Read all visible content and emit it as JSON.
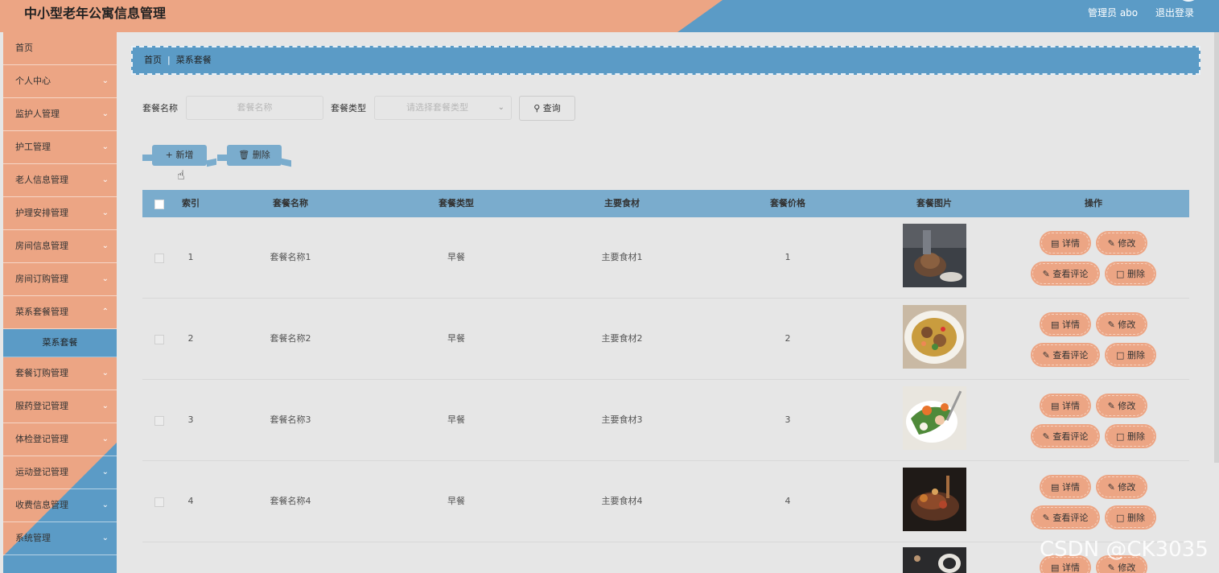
{
  "header": {
    "title": "中小型老年公寓信息管理",
    "user": "管理员 abo",
    "logout": "退出登录"
  },
  "colors": {
    "blue": "#5b9bc6",
    "salmon": "#eca584",
    "table_header": "#7aaccd"
  },
  "sidebar": {
    "items": [
      {
        "label": "首页",
        "arrow": false
      },
      {
        "label": "个人中心",
        "arrow": true
      },
      {
        "label": "监护人管理",
        "arrow": true
      },
      {
        "label": "护工管理",
        "arrow": true
      },
      {
        "label": "老人信息管理",
        "arrow": true
      },
      {
        "label": "护理安排管理",
        "arrow": true
      },
      {
        "label": "房间信息管理",
        "arrow": true
      },
      {
        "label": "房间订购管理",
        "arrow": true
      },
      {
        "label": "菜系套餐管理",
        "arrow": true
      },
      {
        "label": "套餐订购管理",
        "arrow": true
      },
      {
        "label": "服药登记管理",
        "arrow": true
      },
      {
        "label": "体检登记管理",
        "arrow": true
      },
      {
        "label": "运动登记管理",
        "arrow": true
      },
      {
        "label": "收费信息管理",
        "arrow": true
      },
      {
        "label": "系统管理",
        "arrow": true
      }
    ],
    "active_sub": "菜系套餐"
  },
  "breadcrumb": {
    "home": "首页",
    "current": "菜系套餐"
  },
  "search": {
    "name_label": "套餐名称",
    "name_placeholder": "套餐名称",
    "type_label": "套餐类型",
    "type_placeholder": "请选择套餐类型",
    "query_label": "查询"
  },
  "actions": {
    "add_label": "新增",
    "delete_label": "删除"
  },
  "table": {
    "headers": [
      "索引",
      "套餐名称",
      "套餐类型",
      "主要食材",
      "套餐价格",
      "套餐图片",
      "操作"
    ],
    "rows": [
      {
        "index": "1",
        "name": "套餐名称1",
        "type": "早餐",
        "ingredients": "主要食材1",
        "price": "1"
      },
      {
        "index": "2",
        "name": "套餐名称2",
        "type": "早餐",
        "ingredients": "主要食材2",
        "price": "2"
      },
      {
        "index": "3",
        "name": "套餐名称3",
        "type": "早餐",
        "ingredients": "主要食材3",
        "price": "3"
      },
      {
        "index": "4",
        "name": "套餐名称4",
        "type": "早餐",
        "ingredients": "主要食材4",
        "price": "4"
      }
    ],
    "row_actions": {
      "detail": "详情",
      "edit": "修改",
      "comments": "查看评论",
      "delete": "删除"
    }
  },
  "watermark": "CSDN @CK3035"
}
